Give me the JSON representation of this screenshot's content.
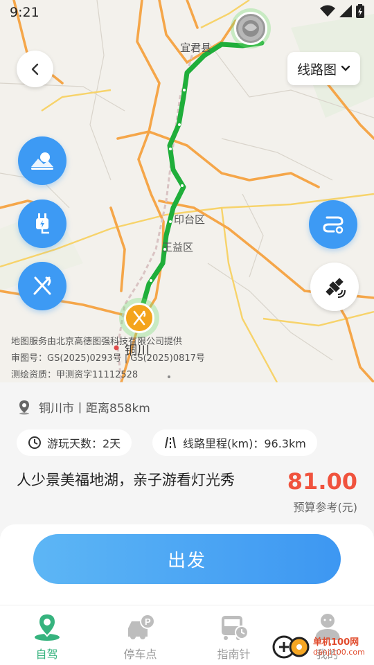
{
  "status_bar": {
    "time": "9:21"
  },
  "map": {
    "route_button_label": "线路图",
    "labels": {
      "county": "宜君县",
      "district1": "印台区",
      "district2": "王益区",
      "city": "铜川"
    },
    "credit": {
      "line1": "地图服务由北京高德图强科技有限公司提供",
      "line2": "审图号：GS(2025)0293号 | GS(2025)0817号",
      "line3": "测绘资质：甲测资字11112528"
    },
    "icons": {
      "back": "back-arrow-icon",
      "scenic": "scenic-icon",
      "charging": "charging-icon",
      "food": "food-icon",
      "route": "route-icon",
      "satellite": "satellite-icon"
    }
  },
  "trip": {
    "location": "铜川市丨距离858km",
    "days": "游玩天数：2天",
    "distance": "线路里程(km)：96.3km",
    "title": "人少景美福地湖，亲子游看灯光秀",
    "price": "81.00",
    "price_label": "预算参考(元)"
  },
  "start_button_label": "出发",
  "nav": [
    {
      "label": "自驾",
      "icon": "map-pin-icon",
      "active": true
    },
    {
      "label": "停车点",
      "icon": "parking-car-icon",
      "active": false
    },
    {
      "label": "指南针",
      "icon": "bus-clock-icon",
      "active": false
    },
    {
      "label": "我的",
      "icon": "user-icon",
      "active": false
    }
  ],
  "watermark": {
    "text": "单机100网",
    "sub": "danji100.com"
  },
  "colors": {
    "accent": "#3d9af4",
    "route": "#1fae3a",
    "price": "#f0533e",
    "nav_active": "#36b37e"
  }
}
